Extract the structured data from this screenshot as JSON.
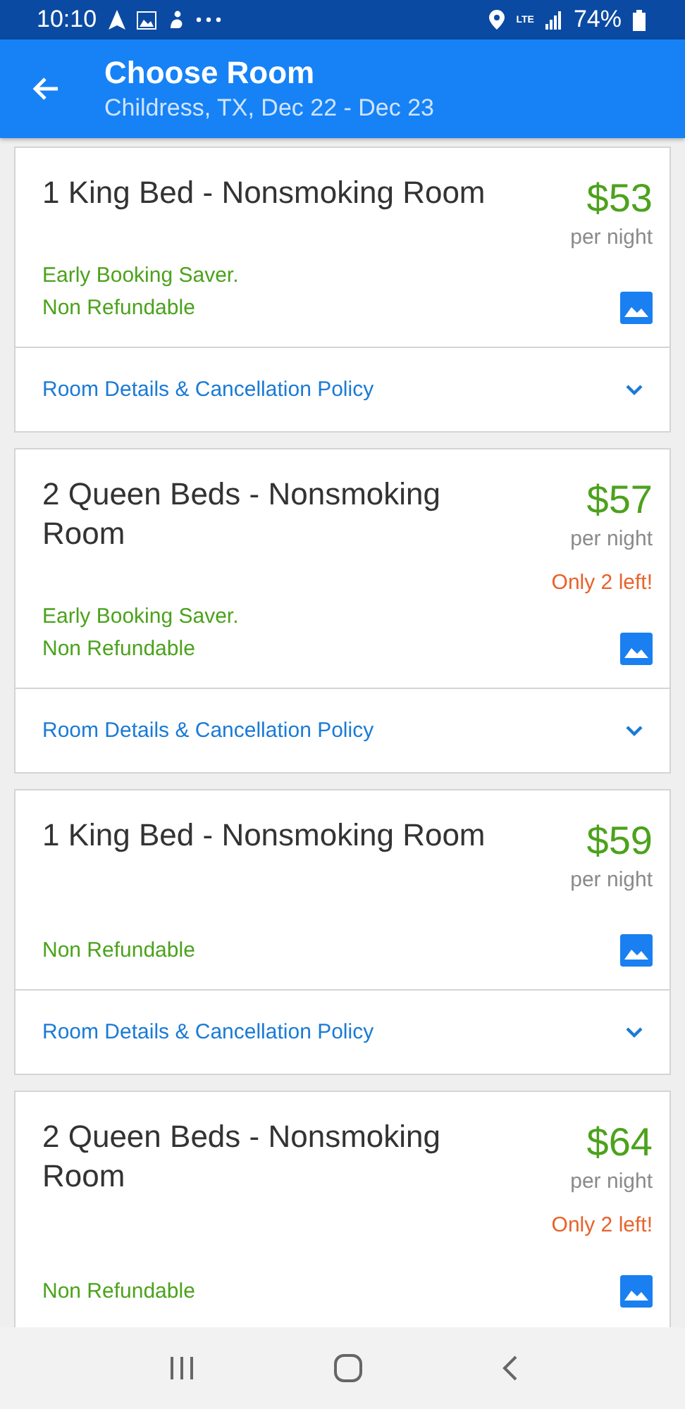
{
  "status_bar": {
    "time": "10:10",
    "network": "LTE",
    "battery": "74%"
  },
  "app_bar": {
    "title": "Choose Room",
    "subtitle": "Childress, TX, Dec 22 - Dec 23"
  },
  "rooms": [
    {
      "name": "1 King Bed - Nonsmoking Room",
      "price": "$53",
      "price_unit": "per night",
      "notes": [
        "Early Booking Saver.",
        "Non Refundable"
      ],
      "details": "Room Details & Cancellation Policy"
    },
    {
      "name": "2 Queen Beds - Nonsmoking Room",
      "price": "$57",
      "price_unit": "per night",
      "availability": "Only 2 left!",
      "notes": [
        "Early Booking Saver.",
        "Non Refundable"
      ],
      "details": "Room Details & Cancellation Policy"
    },
    {
      "name": "1 King Bed - Nonsmoking Room",
      "price": "$59",
      "price_unit": "per night",
      "notes": [
        "Non Refundable"
      ],
      "details": "Room Details & Cancellation Policy"
    },
    {
      "name": "2 Queen Beds - Nonsmoking Room",
      "price": "$64",
      "price_unit": "per night",
      "availability": "Only 2 left!",
      "notes": [
        "Non Refundable"
      ]
    }
  ]
}
